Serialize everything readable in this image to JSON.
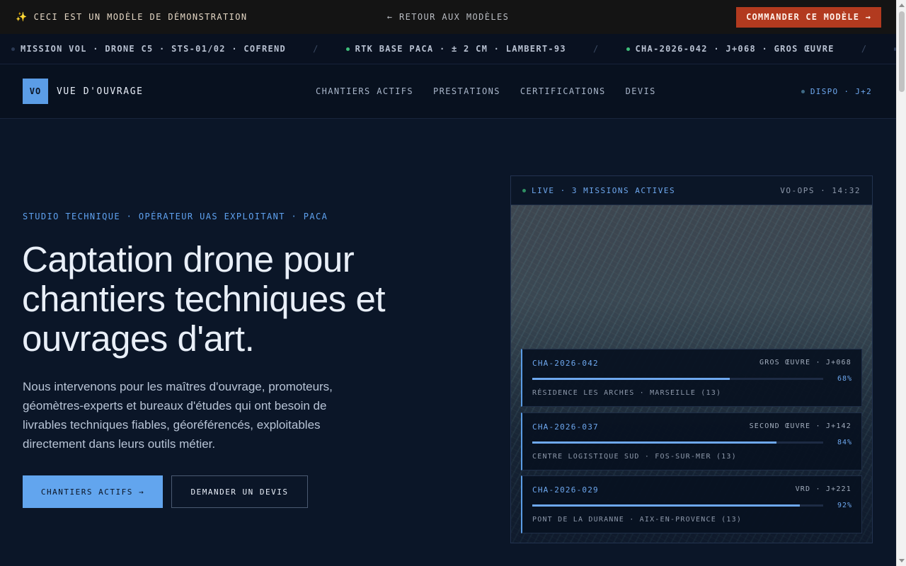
{
  "demo_bar": {
    "notice": "CECI EST UN MODÈLE DE DÉMONSTRATION",
    "back_link": "← RETOUR AUX MODÈLES",
    "order_button": "COMMANDER CE MODÈLE →"
  },
  "ticker": {
    "items": [
      {
        "text": "MISSION VOL · DRONE C5 · STS-01/02 · COFREND",
        "dot_color": "#2b3a55"
      },
      {
        "text": "RTK BASE PACA · ± 2 CM · LAMBERT-93",
        "dot_color": "#3fbf7a"
      },
      {
        "text": "CHA-2026-042 · J+068 · GROS ŒUVRE",
        "dot_color": "#3fbf7a"
      }
    ],
    "separator": "/"
  },
  "header": {
    "logo_mark": "VO",
    "logo_text": "VUE D'OUVRAGE",
    "nav": [
      "CHANTIERS ACTIFS",
      "PRESTATIONS",
      "CERTIFICATIONS",
      "DEVIS"
    ],
    "availability": "DISPO · J+2"
  },
  "hero": {
    "eyebrow": "STUDIO TECHNIQUE · OPÉRATEUR UAS EXPLOITANT · PACA",
    "title": "Captation drone pour chantiers techniques et ouvrages d'art.",
    "description": "Nous intervenons pour les maîtres d'ouvrage, promoteurs, géomètres-experts et bureaux d'études qui ont besoin de livrables techniques fiables, géoréférencés, exploitables directement dans leurs outils métier.",
    "primary_button": "CHANTIERS ACTIFS →",
    "secondary_button": "DEMANDER UN DEVIS"
  },
  "panel": {
    "live_label": "LIVE · 3 MISSIONS ACTIVES",
    "ops_label": "VO-OPS · 14:32",
    "missions": [
      {
        "id": "CHA-2026-042",
        "phase": "GROS ŒUVRE · J+068",
        "progress": 68,
        "progress_label": "68%",
        "location": "RÉSIDENCE LES ARCHES · MARSEILLE (13)"
      },
      {
        "id": "CHA-2026-037",
        "phase": "SECOND ŒUVRE · J+142",
        "progress": 84,
        "progress_label": "84%",
        "location": "CENTRE LOGISTIQUE SUD · FOS-SUR-MER (13)"
      },
      {
        "id": "CHA-2026-029",
        "phase": "VRD · J+221",
        "progress": 92,
        "progress_label": "92%",
        "location": "PONT DE LA DURANNE · AIX-EN-PROVENCE (13)"
      }
    ]
  }
}
